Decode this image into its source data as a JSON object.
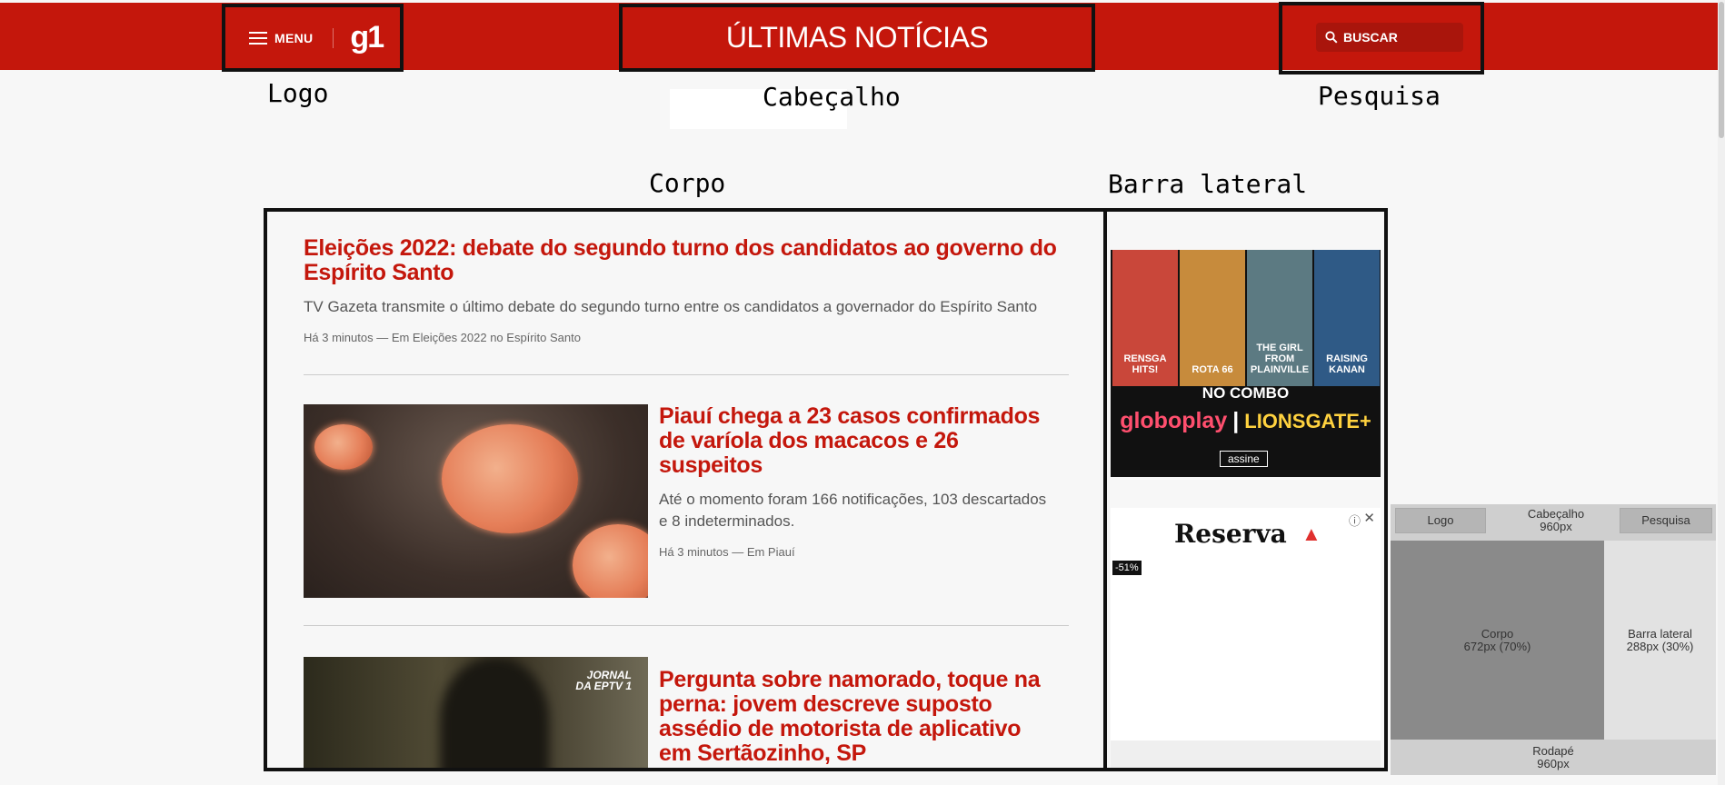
{
  "header": {
    "menu_label": "MENU",
    "logo_text": "g1",
    "title": "ÚLTIMAS NOTÍCIAS",
    "search_label": "BUSCAR"
  },
  "annotations": {
    "logo": "Logo",
    "cabecalho": "Cabeçalho",
    "pesquisa": "Pesquisa",
    "corpo": "Corpo",
    "barra_lateral": "Barra lateral"
  },
  "articles": [
    {
      "headline": "Eleições 2022: debate do segundo turno dos candidatos ao governo do Espírito Santo",
      "summary": "TV Gazeta transmite o último debate do segundo turno entre os candidatos a governador do Espírito Santo",
      "meta": "Há 3 minutos — Em Eleições 2022 no Espírito Santo"
    },
    {
      "headline": "Piauí chega a 23 casos confirmados de varíola dos macacos e 26 suspeitos",
      "summary": "Até o momento foram 166 notificações, 103 descartados e 8 indeterminados.",
      "meta": "Há 3 minutos — Em Piauí"
    },
    {
      "headline": "Pergunta sobre namorado, toque na perna: jovem descreve suposto assédio de motorista de aplicativo em Sertãozinho, SP",
      "thumb_badge_line1": "JORNAL",
      "thumb_badge_line2": "DA EPTV 1"
    }
  ],
  "ads": {
    "streaming": {
      "posters": [
        "RENSGA HITS!",
        "ROTA 66",
        "THE GIRL FROM PLAINVILLE",
        "RAISING KANAN"
      ],
      "combo_label": "NO COMBO",
      "brand_a": "globoplay",
      "brand_b": "LIONSGATE+",
      "cta": "assine",
      "poster_colors": [
        "#c9473a",
        "#c78b3c",
        "#5c7a82",
        "#2f5a86"
      ]
    },
    "retail": {
      "brand": "Reserva",
      "discount": "-51%",
      "info_icon": "info-icon",
      "close_icon": "close-icon"
    }
  },
  "diagram": {
    "logo": "Logo",
    "header_line1": "Cabeçalho",
    "header_line2": "960px",
    "search": "Pesquisa",
    "body_line1": "Corpo",
    "body_line2": "672px (70%)",
    "side_line1": "Barra lateral",
    "side_line2": "288px (30%)",
    "footer_line1": "Rodapé",
    "footer_line2": "960px"
  },
  "colors": {
    "brand_red": "#c4170c",
    "search_pill": "#a9150c"
  }
}
